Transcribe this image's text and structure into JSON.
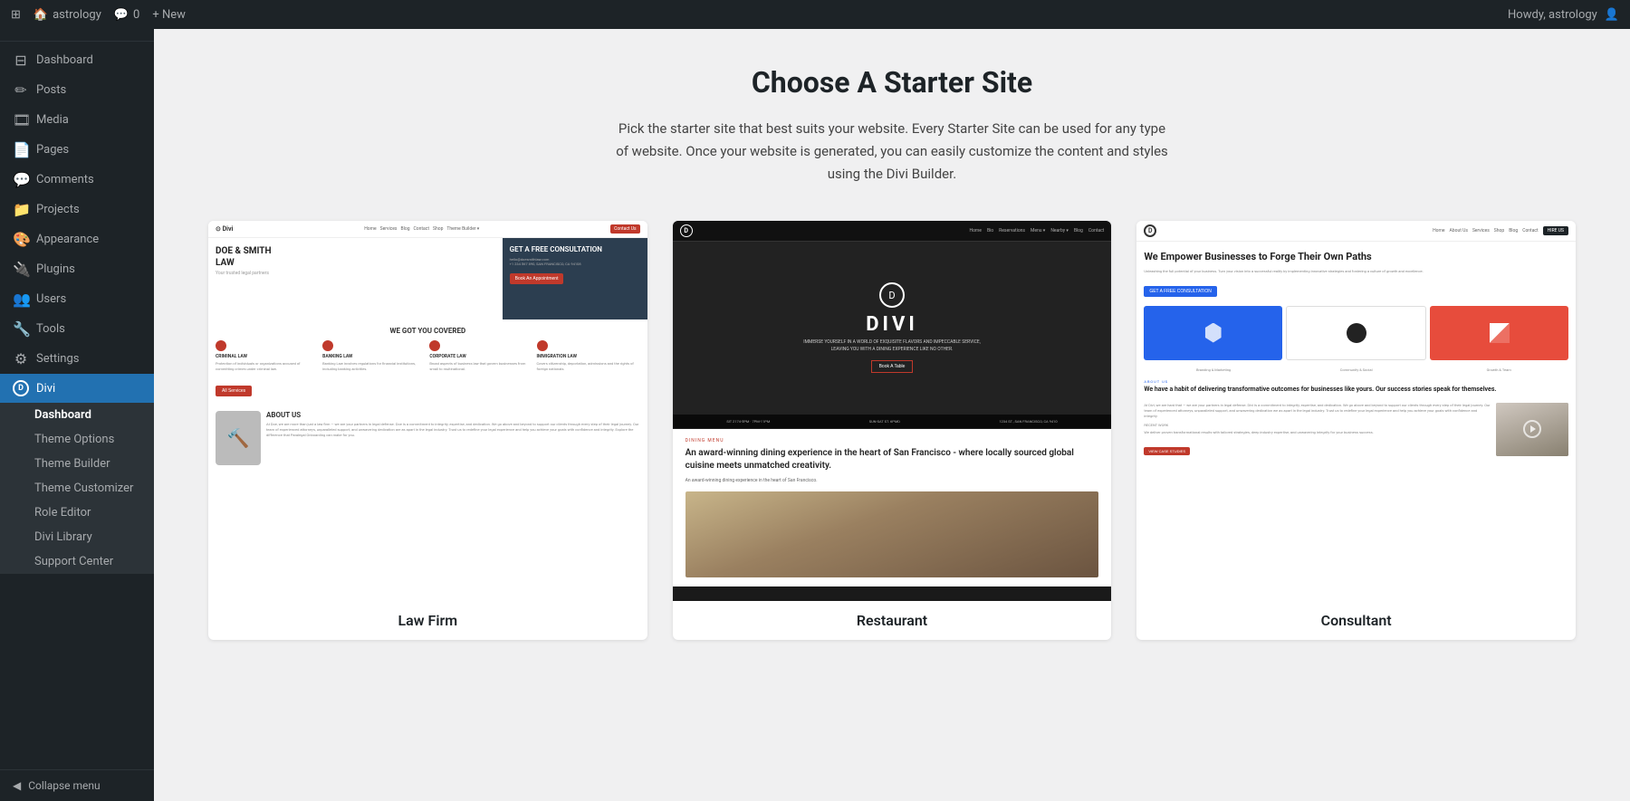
{
  "topbar": {
    "wp_logo": "⊞",
    "site_name": "astrology",
    "comments_icon": "💬",
    "comments_count": "0",
    "new_label": "+ New",
    "greeting": "Howdy, astrology",
    "avatar_icon": "👤"
  },
  "sidebar": {
    "logo": "⊞",
    "site": "astrology",
    "items": [
      {
        "label": "Dashboard",
        "icon": "⊟"
      },
      {
        "label": "Posts",
        "icon": "📝"
      },
      {
        "label": "Media",
        "icon": "🖼"
      },
      {
        "label": "Pages",
        "icon": "📄"
      },
      {
        "label": "Comments",
        "icon": "💬"
      },
      {
        "label": "Projects",
        "icon": "📁"
      },
      {
        "label": "Appearance",
        "icon": "🎨"
      },
      {
        "label": "Plugins",
        "icon": "🔌"
      },
      {
        "label": "Users",
        "icon": "👥"
      },
      {
        "label": "Tools",
        "icon": "🔧"
      },
      {
        "label": "Settings",
        "icon": "⚙"
      }
    ],
    "divi": {
      "label": "Divi",
      "subitems": [
        {
          "label": "Dashboard",
          "active": true
        },
        {
          "label": "Theme Options"
        },
        {
          "label": "Theme Builder"
        },
        {
          "label": "Theme Customizer"
        },
        {
          "label": "Role Editor"
        },
        {
          "label": "Divi Library"
        },
        {
          "label": "Support Center"
        }
      ]
    },
    "collapse_label": "Collapse menu"
  },
  "main": {
    "title": "Choose A Starter Site",
    "subtitle": "Pick the starter site that best suits your website. Every Starter Site can be used for any type of website. Once your website is generated, you can easily customize the content and styles using the Divi Builder.",
    "cards": [
      {
        "label": "Law Firm"
      },
      {
        "label": "Restaurant"
      },
      {
        "label": "Consultant"
      }
    ]
  }
}
